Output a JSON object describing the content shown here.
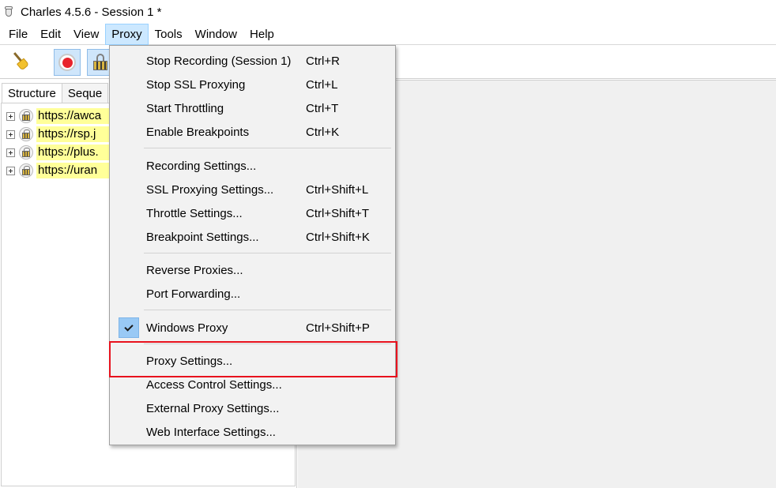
{
  "window": {
    "title": "Charles 4.5.6 - Session 1 *"
  },
  "menubar": {
    "items": [
      {
        "label": "File"
      },
      {
        "label": "Edit"
      },
      {
        "label": "View"
      },
      {
        "label": "Proxy",
        "open": true
      },
      {
        "label": "Tools"
      },
      {
        "label": "Window"
      },
      {
        "label": "Help"
      }
    ]
  },
  "toolbar": {
    "buttons": [
      {
        "icon": "broom-icon"
      },
      {
        "icon": "record-icon",
        "pressed": true
      },
      {
        "icon": "ssl-lock-icon",
        "pressed": true
      }
    ]
  },
  "left_panel": {
    "tabs": [
      {
        "label": "Structure",
        "active": true
      },
      {
        "label": "Seque"
      }
    ],
    "hosts": [
      {
        "label": "https://awca"
      },
      {
        "label": "https://rsp.j"
      },
      {
        "label": "https://plus."
      },
      {
        "label": "https://uran"
      }
    ],
    "host_highlight_color": "#ffff99"
  },
  "proxy_menu": {
    "items": [
      {
        "label": "Stop Recording (Session 1)",
        "shortcut": "Ctrl+R"
      },
      {
        "label": "Stop SSL Proxying",
        "shortcut": "Ctrl+L"
      },
      {
        "label": "Start Throttling",
        "shortcut": "Ctrl+T"
      },
      {
        "label": "Enable Breakpoints",
        "shortcut": "Ctrl+K"
      },
      {
        "label": "Recording Settings...",
        "shortcut": ""
      },
      {
        "label": "SSL Proxying Settings...",
        "shortcut": "Ctrl+Shift+L"
      },
      {
        "label": "Throttle Settings...",
        "shortcut": "Ctrl+Shift+T"
      },
      {
        "label": "Breakpoint Settings...",
        "shortcut": "Ctrl+Shift+K"
      },
      {
        "label": "Reverse Proxies...",
        "shortcut": ""
      },
      {
        "label": "Port Forwarding...",
        "shortcut": ""
      },
      {
        "label": "Windows Proxy",
        "shortcut": "Ctrl+Shift+P",
        "checked": true
      },
      {
        "label": "Proxy Settings...",
        "shortcut": "",
        "highlighted": true
      },
      {
        "label": "Access Control Settings...",
        "shortcut": ""
      },
      {
        "label": "External Proxy Settings...",
        "shortcut": ""
      },
      {
        "label": "Web Interface Settings...",
        "shortcut": ""
      }
    ],
    "highlight_color": "#e8121e"
  }
}
